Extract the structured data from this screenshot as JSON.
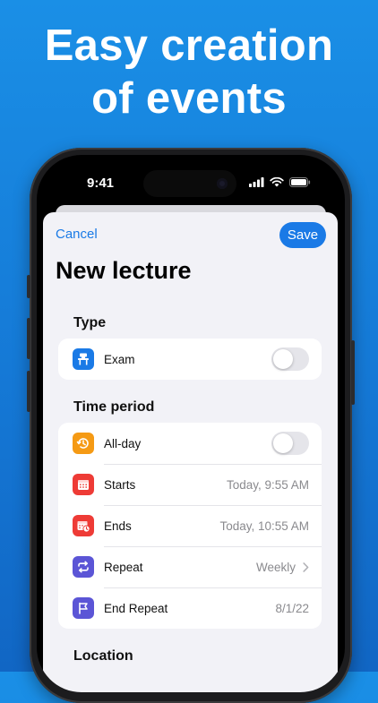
{
  "promo": {
    "headline_line1": "Easy creation",
    "headline_line2": "of events"
  },
  "status_bar": {
    "time": "9:41",
    "icons": [
      "signal-icon",
      "wifi-icon",
      "battery-icon"
    ]
  },
  "nav": {
    "cancel_label": "Cancel",
    "save_label": "Save"
  },
  "sheet": {
    "title": "New lecture"
  },
  "sections": {
    "type": {
      "header": "Type",
      "rows": [
        {
          "label": "Exam",
          "icon": "exam-desk-icon",
          "toggle_on": false
        }
      ]
    },
    "time_period": {
      "header": "Time period",
      "rows": [
        {
          "label": "All-day",
          "icon": "clock-arrow-icon",
          "toggle_on": false
        },
        {
          "label": "Starts",
          "icon": "calendar-icon",
          "value": "Today, 9:55 AM"
        },
        {
          "label": "Ends",
          "icon": "calendar-clock-icon",
          "value": "Today, 10:55 AM"
        },
        {
          "label": "Repeat",
          "icon": "repeat-icon",
          "value": "Weekly"
        },
        {
          "label": "End Repeat",
          "icon": "flag-icon",
          "value": "8/1/22"
        }
      ]
    },
    "location": {
      "header": "Location"
    }
  },
  "colors": {
    "accent": "#1a7ae6",
    "background_blue": "#1579d6",
    "exam_icon": "#1a7ae6",
    "allday_icon": "#f59a14",
    "calendar_icon": "#ee3b36",
    "repeat_icon": "#5b55d6"
  }
}
